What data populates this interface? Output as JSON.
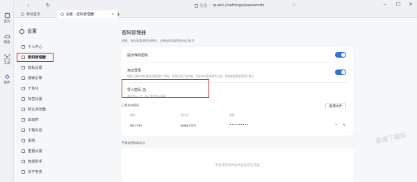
{
  "rail": {
    "items": [
      {
        "label": "首页",
        "icon": "home-icon"
      },
      {
        "label": "网盘",
        "icon": "cloud-icon"
      },
      {
        "label": "工具",
        "icon": "scan-icon"
      },
      {
        "label": "插件",
        "icon": "plugin-icon"
      }
    ]
  },
  "browser": {
    "back": "‹",
    "reload": "↻",
    "secure_text": "安全",
    "url": "quark://settings/passwords",
    "star": "☆",
    "window_controls": [
      "–",
      "□",
      "✕"
    ],
    "tabs": [
      {
        "label": "新标签页"
      },
      {
        "label": "设置 - 密码管理器"
      }
    ],
    "tab_add": "+"
  },
  "settings": {
    "title": "设置",
    "items": [
      {
        "label": "个人中心",
        "icon": "user-icon"
      },
      {
        "label": "密码管理器",
        "icon": "key-icon",
        "active": true
      },
      {
        "label": "隐私设置",
        "icon": "privacy-icon"
      },
      {
        "label": "搜索引擎",
        "icon": "search-icon"
      },
      {
        "label": "个性化",
        "icon": "palette-icon"
      },
      {
        "label": "标签设置",
        "icon": "tab-icon"
      },
      {
        "label": "默认浏览器",
        "icon": "browser-icon"
      },
      {
        "label": "启动时",
        "icon": "power-icon"
      },
      {
        "label": "下载内容",
        "icon": "download-icon"
      },
      {
        "label": "系统",
        "icon": "system-icon"
      },
      {
        "label": "重置设置",
        "icon": "reset-icon"
      },
      {
        "label": "智能助手",
        "icon": "assistant-icon"
      },
      {
        "label": "关于夸克",
        "icon": "info-icon"
      }
    ]
  },
  "main": {
    "title": "密码管理器",
    "subtitle": "创建、保存和管理您的密码，以便轻松登录您的站点账号",
    "offer_save": {
      "title": "提示保存密码",
      "on": true
    },
    "auto_login": {
      "title": "自动登录",
      "desc": "使用已保存的凭据自动登录各个网站。如果关闭了该功能，则在每次登录网站之前，系统都会要求您进行确认",
      "on": true
    },
    "import": {
      "title": "导入密码",
      "help": "?",
      "desc": "通过导入一个 CSV 文件导入密码",
      "button": "选择文件"
    },
    "saved_label": "已保存的密码",
    "columns": [
      "网站",
      "用户名",
      "密码"
    ],
    "saved_rows": [
      {
        "site": "qq.com",
        "user": "@qq.com",
        "password": "••••••••••"
      }
    ],
    "never_label": "不保存密码的站点",
    "never_empty": "不保存密码的站点会显示在这里",
    "watermark": "极速下载站"
  },
  "colors": {
    "accent": "#2f6fef",
    "highlight": "#d9272d"
  }
}
